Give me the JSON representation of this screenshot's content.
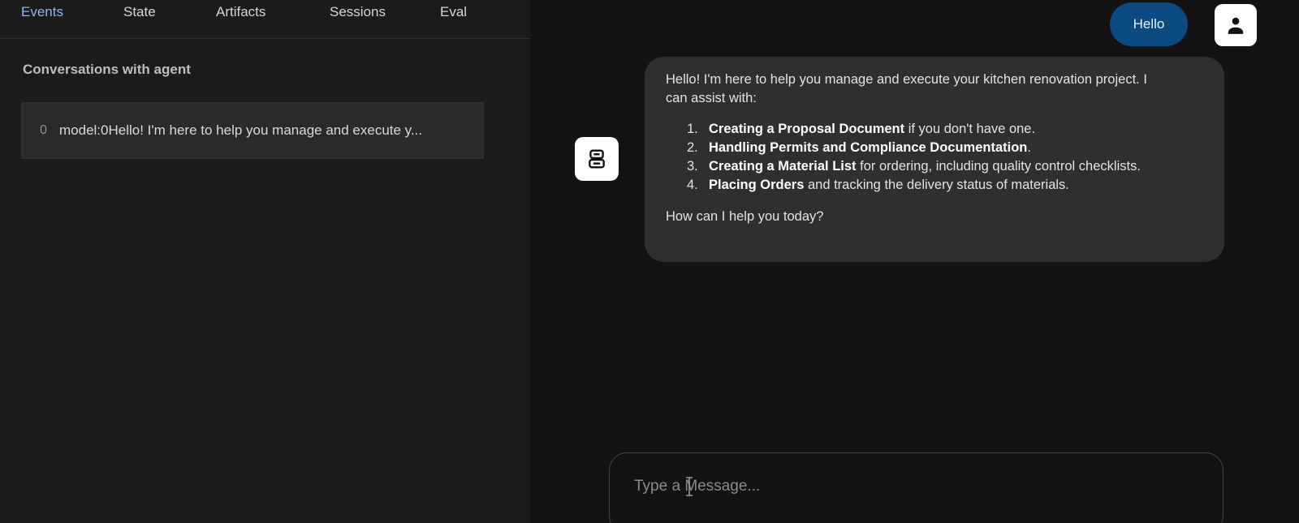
{
  "tabs": [
    {
      "label": "Events"
    },
    {
      "label": "State"
    },
    {
      "label": "Artifacts"
    },
    {
      "label": "Sessions"
    },
    {
      "label": "Eval"
    }
  ],
  "active_tab": "Events",
  "events_panel": {
    "title": "Conversations with agent",
    "rows": [
      {
        "index": "0",
        "text": "model:0Hello! I'm here to help you manage and execute y..."
      }
    ]
  },
  "chat": {
    "user_message": "Hello",
    "bot_message": {
      "intro": "Hello! I'm here to help you manage and execute your kitchen renovation project. I can assist with:",
      "items": [
        {
          "num": "1.",
          "bold": "Creating a Proposal Document",
          "rest": " if you don't have one."
        },
        {
          "num": "2.",
          "bold": "Handling Permits and Compliance Documentation",
          "rest": "."
        },
        {
          "num": "3.",
          "bold": "Creating a Material List",
          "rest": " for ordering, including quality control checklists."
        },
        {
          "num": "4.",
          "bold": "Placing Orders",
          "rest": " and tracking the delivery status of materials."
        }
      ],
      "outro": "How can I help you today?"
    },
    "composer": {
      "placeholder": "Type a Message..."
    }
  },
  "colors": {
    "active_tab": "#8ab4f8",
    "user_bubble": "#0b4a80",
    "bot_bubble": "#2f2f31",
    "background": "#131314"
  },
  "icons": {
    "user_avatar": "person-icon",
    "bot_avatar": "robot-icon"
  }
}
